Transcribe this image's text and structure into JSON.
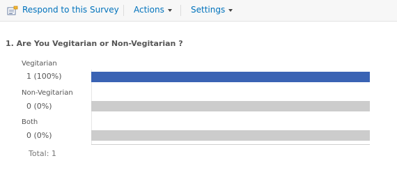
{
  "toolbar": {
    "respond_label": "Respond to this Survey",
    "actions_label": "Actions",
    "settings_label": "Settings"
  },
  "question": {
    "title": "1. Are You Vegitarian or Non-Vegitarian ?",
    "answers": [
      {
        "label": "Vegitarian",
        "count_text": "1 (100%)",
        "fraction": 1.0
      },
      {
        "label": "Non-Vegitarian",
        "count_text": "0 (0%)",
        "fraction": 0.0
      },
      {
        "label": "Both",
        "count_text": "0 (0%)",
        "fraction": 0.0
      }
    ],
    "total_text": "Total: 1"
  },
  "colors": {
    "bar_fill": "#3a63b4",
    "bar_track": "#cccccc",
    "link": "#0072bc"
  },
  "icons": {
    "respond": "survey-respond-icon",
    "dropdown": "chevron-down-icon"
  }
}
